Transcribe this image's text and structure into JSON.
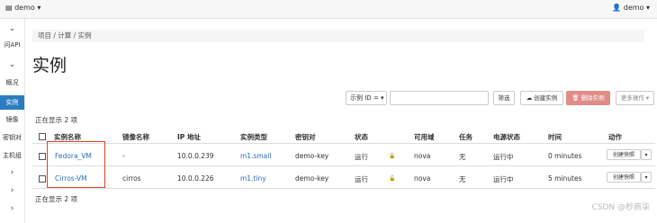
{
  "topbar": {
    "project": "▤ demo ▾",
    "user": "👤 demo ▾"
  },
  "sidebar": {
    "items": [
      {
        "label": "⌄",
        "kind": "chev"
      },
      {
        "label": "问API",
        "kind": "item"
      },
      {
        "label": "⌄",
        "kind": "chev"
      },
      {
        "label": "概况",
        "kind": "item"
      },
      {
        "label": "实例",
        "kind": "active"
      },
      {
        "label": "镜像",
        "kind": "item"
      },
      {
        "label": "密钥对",
        "kind": "item"
      },
      {
        "label": "主机组",
        "kind": "item"
      },
      {
        "label": "›",
        "kind": "chev"
      },
      {
        "label": "›",
        "kind": "chev"
      },
      {
        "label": "›",
        "kind": "chev"
      }
    ]
  },
  "breadcrumb": "项目 / 计算 / 实例",
  "page_title": "实例",
  "toolbar": {
    "filter_select": "示例 ID = ▾",
    "filter_btn": "筛选",
    "create_btn": "☁ 创建实例",
    "delete_btn": "🗑 删除实例",
    "more_btn": "更多操作 ▾"
  },
  "count_top": "正在显示 2 项",
  "count_bottom": "正在显示 2 项",
  "table": {
    "headers": [
      "实例名称",
      "镜像名称",
      "IP 地址",
      "实例类型",
      "密钥对",
      "状态",
      "可用域",
      "任务",
      "电源状态",
      "时间",
      "动作"
    ],
    "rows": [
      {
        "name": "Fedora_VM",
        "image": "-",
        "ip": "10.0.0.239",
        "flavor": "m1.small",
        "key": "demo-key",
        "status": "运行",
        "zone": "nova",
        "task": "无",
        "power": "运行中",
        "time": "0 minutes",
        "action": "创建快照"
      },
      {
        "name": "Cirros-VM",
        "image": "cirros",
        "ip": "10.0.0.226",
        "flavor": "m1.tiny",
        "key": "demo-key",
        "status": "运行",
        "zone": "nova",
        "task": "无",
        "power": "运行中",
        "time": "5 minutes",
        "action": "创建快照"
      }
    ]
  },
  "watermark": "CSDN @杪商柒",
  "colors": {
    "accent": "#2c7dbf",
    "link": "#2a6ebb",
    "danger": "#e08c88",
    "highlight": "#e0402a"
  }
}
